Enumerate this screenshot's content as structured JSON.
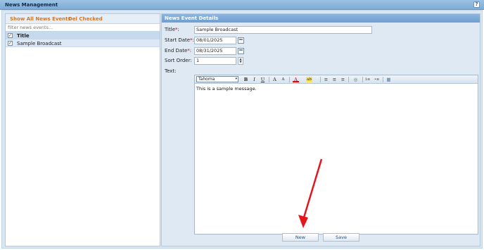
{
  "window": {
    "title": "News Management",
    "help_label": "?"
  },
  "left": {
    "show_all_label": "Show All News Events",
    "del_checked_label": "Del Checked",
    "filter_placeholder": "filter news events...",
    "column_title": "Title",
    "items": [
      {
        "title": "Sample Broadcast",
        "checked": true
      }
    ]
  },
  "right": {
    "header": "News Event Details",
    "title_label": "Title",
    "title_value": "Sample Broadcast",
    "start_label": "Start Date",
    "start_value": "08/01/2025",
    "end_label": "End Date",
    "end_value": "08/31/2025",
    "sort_label": "Sort Order:",
    "sort_value": "1",
    "text_label": "Text:",
    "required_mark": "*",
    "colon": ":",
    "check_mark": "✓",
    "spin_up": "▲",
    "spin_down": "▼"
  },
  "editor": {
    "font": "Tahoma",
    "font_arrow": "▾",
    "tools": [
      "B",
      "I",
      "U",
      "A",
      "A",
      "A",
      "ab",
      "≡",
      "≡",
      "≡",
      "◎",
      "1≡",
      "•≡",
      "▦"
    ],
    "body_text": "This is a sample message."
  },
  "buttons": {
    "new_label": "New",
    "save_label": "Save"
  },
  "colors": {
    "accent": "#6f9fd0",
    "link": "#d2772a",
    "arrow": "#e3161b"
  }
}
